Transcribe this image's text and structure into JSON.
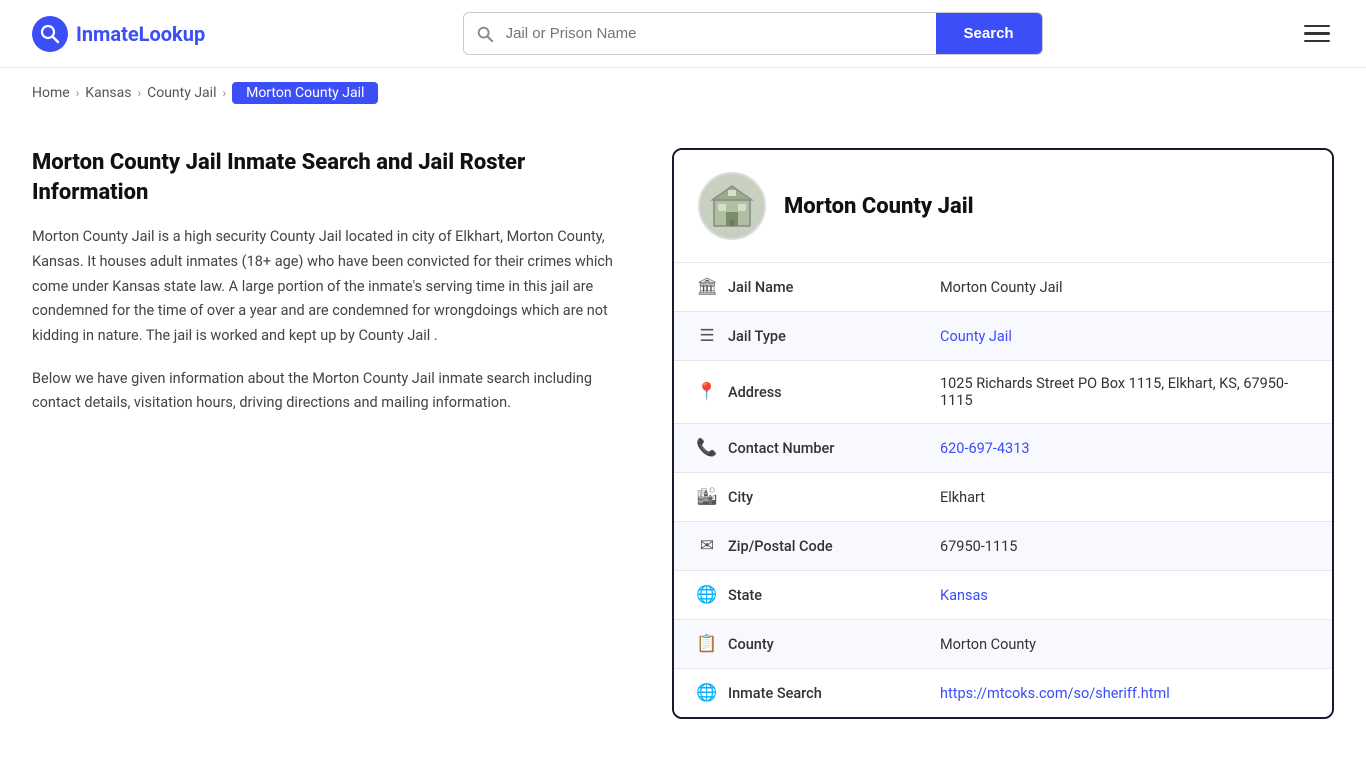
{
  "header": {
    "logo_text_part1": "Inmate",
    "logo_text_part2": "Lookup",
    "search_placeholder": "Jail or Prison Name",
    "search_button_label": "Search"
  },
  "breadcrumb": {
    "home": "Home",
    "state": "Kansas",
    "type": "County Jail",
    "current": "Morton County Jail"
  },
  "left": {
    "title": "Morton County Jail Inmate Search and Jail Roster Information",
    "description1": "Morton County Jail is a high security County Jail located in city of Elkhart, Morton County, Kansas. It houses adult inmates (18+ age) who have been convicted for their crimes which come under Kansas state law. A large portion of the inmate's serving time in this jail are condemned for the time of over a year and are condemned for wrongdoings which are not kidding in nature. The jail is worked and kept up by County Jail .",
    "description2": "Below we have given information about the Morton County Jail inmate search including contact details, visitation hours, driving directions and mailing information."
  },
  "card": {
    "jail_name_heading": "Morton County Jail",
    "fields": [
      {
        "icon": "🏛",
        "label": "Jail Name",
        "value": "Morton County Jail",
        "link": false
      },
      {
        "icon": "☰",
        "label": "Jail Type",
        "value": "County Jail",
        "link": true,
        "href": "#"
      },
      {
        "icon": "📍",
        "label": "Address",
        "value": "1025 Richards Street PO Box 1115, Elkhart, KS, 67950-1115",
        "link": false
      },
      {
        "icon": "📞",
        "label": "Contact Number",
        "value": "620-697-4313",
        "link": true,
        "href": "tel:6206974313"
      },
      {
        "icon": "🏙",
        "label": "City",
        "value": "Elkhart",
        "link": false
      },
      {
        "icon": "✉",
        "label": "Zip/Postal Code",
        "value": "67950-1115",
        "link": false
      },
      {
        "icon": "🌐",
        "label": "State",
        "value": "Kansas",
        "link": true,
        "href": "#"
      },
      {
        "icon": "📋",
        "label": "County",
        "value": "Morton County",
        "link": false
      },
      {
        "icon": "🌐",
        "label": "Inmate Search",
        "value": "https://mtcoks.com/so/sheriff.html",
        "link": true,
        "href": "https://mtcoks.com/so/sheriff.html"
      }
    ]
  }
}
